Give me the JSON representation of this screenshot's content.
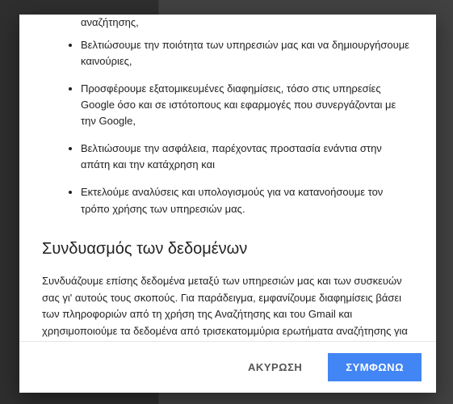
{
  "dialog": {
    "partial_top": "αναζήτησης,",
    "bullets": [
      "Βελτιώσουμε την ποιότητα των υπηρεσιών μας και να δημιουργήσουμε καινούριες,",
      "Προσφέρουμε εξατομικευμένες διαφημίσεις, τόσο στις υπηρεσίες Google όσο και σε ιστότοπους και εφαρμογές που συνεργάζονται με την Google,",
      "Βελτιώσουμε την ασφάλεια, παρέχοντας προστασία ενάντια στην απάτη και την κατάχρηση και",
      "Εκτελούμε αναλύσεις και υπολογισμούς για να κατανοήσουμε τον τρόπο χρήσης των υπηρεσιών μας."
    ],
    "section_heading": "Συνδυασμός των δεδομένων",
    "section_body": "Συνδυάζουμε επίσης δεδομένα μεταξύ των υπηρεσιών μας και των συσκευών σας γι' αυτούς τους σκοπούς. Για παράδειγμα, εμφανίζουμε διαφημίσεις βάσει των πληροφοριών από τη χρήση της Αναζήτησης και του Gmail και χρησιμοποιούμε τα δεδομένα από τρισεκατομμύρια ερωτήματα αναζήτησης για να δημιουργήσουμε μοντέλα διόρθωσης ορθογραφίας τα οποία χρησιμοποιούμε σε όλες τις υπηρεσίες μας.",
    "actions": {
      "cancel": "ΑΚΥΡΩΣΗ",
      "agree": "ΣΥΜΦΩΝΩ"
    }
  }
}
